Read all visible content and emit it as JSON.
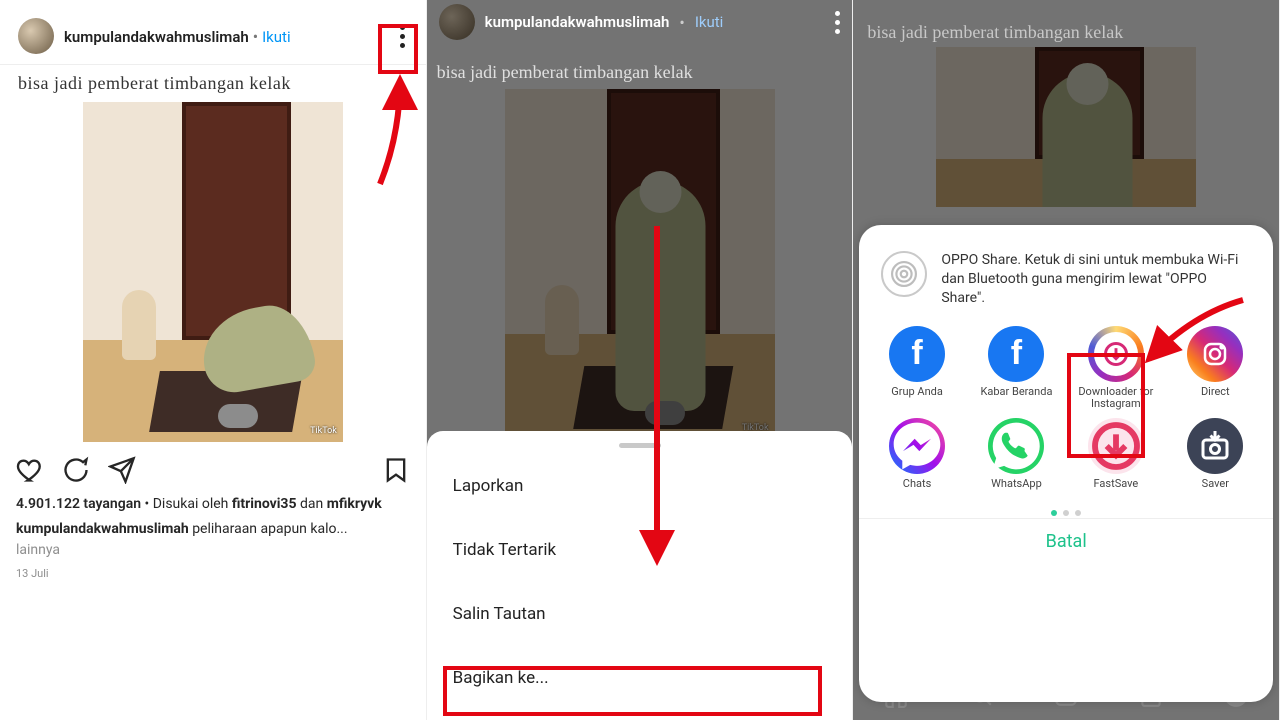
{
  "panel1": {
    "username": "kumpulandakwahmuslimah",
    "separator": "•",
    "follow": "Ikuti",
    "caption_top": "bisa jadi pemberat timbangan kelak",
    "tiktok_tag": "TikTok",
    "views_value": "4.901.122 tayangan",
    "liked_prefix": "Disukai oleh",
    "liked_user1": "fitrinovi35",
    "liked_conj": "dan",
    "liked_user2": "mfikryvk",
    "caption_user": "kumpulandakwahmuslimah",
    "caption_text": "peliharaan apapun kalo...",
    "more_link": "lainnya",
    "date": "13 Juli"
  },
  "panel2": {
    "username": "kumpulandakwahmuslimah",
    "separator": "•",
    "follow": "Ikuti",
    "caption_top": "bisa jadi pemberat timbangan kelak",
    "menu": {
      "report": "Laporkan",
      "not_interested": "Tidak Tertarik",
      "copy_link": "Salin Tautan",
      "share_to": "Bagikan ke..."
    }
  },
  "panel3": {
    "caption_top": "bisa jadi pemberat timbangan kelak",
    "oppo_text": "OPPO Share. Ketuk di sini untuk membuka Wi-Fi dan Bluetooth guna mengirim lewat \"OPPO Share\".",
    "apps": {
      "fb_group": "Grup Anda",
      "fb_news": "Kabar Beranda",
      "ig_downloader": "Downloader for Instagram",
      "direct": "Direct",
      "chats": "Chats",
      "whatsapp": "WhatsApp",
      "fastsave": "FastSave",
      "saver": "Saver"
    },
    "cancel": "Batal"
  }
}
